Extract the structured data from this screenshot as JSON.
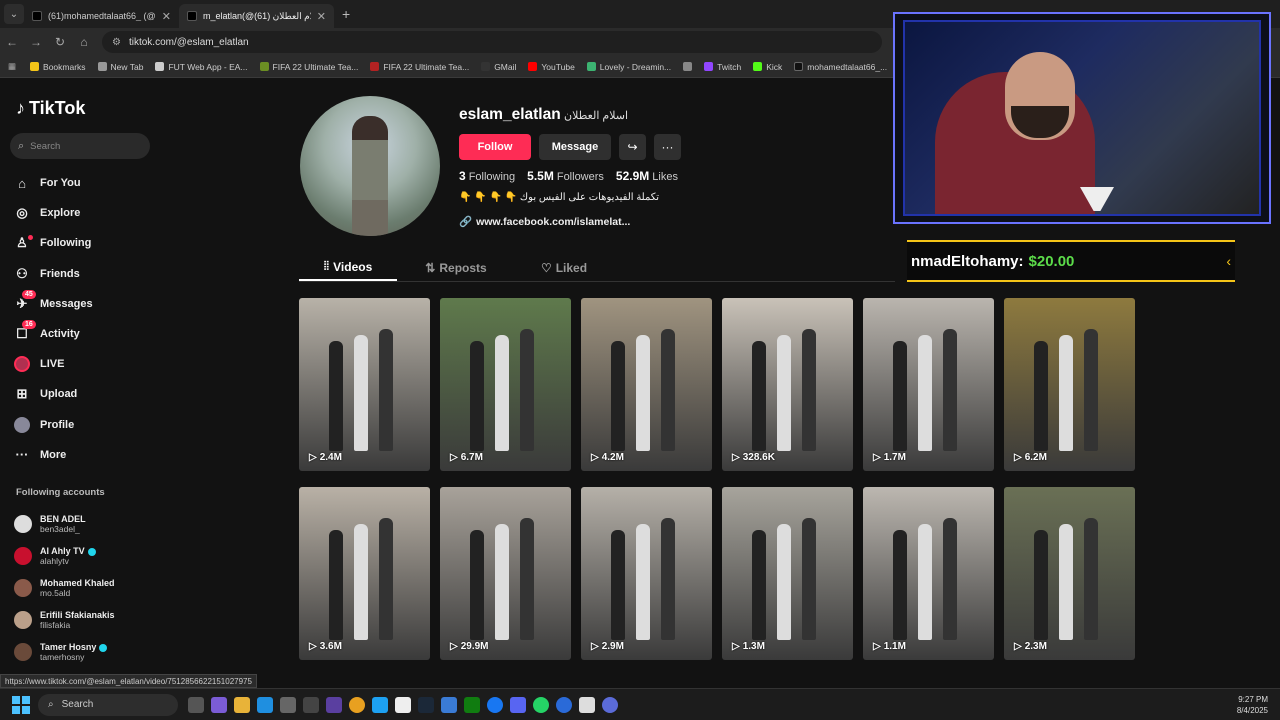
{
  "browser": {
    "tabs": [
      {
        "title": "(61)mohamedtalaat66_ (@moh",
        "active": false
      },
      {
        "title": "m_elatlan(@اسلام العطلان (61)",
        "active": true
      }
    ],
    "url": "tiktok.com/@eslam_elatlan",
    "bookmarks": [
      {
        "label": "Bookmarks",
        "color": "#f5c518"
      },
      {
        "label": "New Tab",
        "color": "#999999"
      },
      {
        "label": "FUT Web App - EA...",
        "color": "#cccccc"
      },
      {
        "label": "FIFA 22 Ultimate Tea...",
        "color": "#6b8e23"
      },
      {
        "label": "FIFA 22 Ultimate Tea...",
        "color": "#b22222"
      },
      {
        "label": "GMail",
        "color": "#333333"
      },
      {
        "label": "YouTube",
        "color": "#ff0000"
      },
      {
        "label": "Lovely - Dreamin...",
        "color": "#3cb371"
      },
      {
        "label": "",
        "color": "#888888"
      },
      {
        "label": "Twitch",
        "color": "#9146ff"
      },
      {
        "label": "Kick",
        "color": "#53fc18"
      },
      {
        "label": "mohamedtalaat66_...",
        "color": "#111111"
      }
    ],
    "status_url": "https://www.tiktok.com/@eslam_elatlan/video/7512856622151027975"
  },
  "sidebar": {
    "logo": "TikTok",
    "search_placeholder": "Search",
    "nav": [
      {
        "label": "For You",
        "icon": "home-icon"
      },
      {
        "label": "Explore",
        "icon": "compass-icon"
      },
      {
        "label": "Following",
        "icon": "following-icon"
      },
      {
        "label": "Friends",
        "icon": "friends-icon"
      },
      {
        "label": "Messages",
        "icon": "messages-icon",
        "badge": "45"
      },
      {
        "label": "Activity",
        "icon": "activity-icon",
        "badge": "16"
      },
      {
        "label": "LIVE",
        "icon": "live-icon"
      },
      {
        "label": "Upload",
        "icon": "upload-icon"
      },
      {
        "label": "Profile",
        "icon": "profile-icon"
      },
      {
        "label": "More",
        "icon": "more-icon"
      }
    ],
    "following_title": "Following accounts",
    "following": [
      {
        "name": "BEN ADEL",
        "handle": "ben3adel_",
        "verified": false,
        "color": "#dddddd"
      },
      {
        "name": "Al Ahly TV",
        "handle": "alahlytv",
        "verified": true,
        "color": "#c8102e"
      },
      {
        "name": "Mohamed Khaled",
        "handle": "mo.5ald",
        "verified": false,
        "color": "#8a5a4a"
      },
      {
        "name": "Erifili Sfakianakis",
        "handle": "filisfakia",
        "verified": false,
        "color": "#bba08a"
      },
      {
        "name": "Tamer Hosny",
        "handle": "tamerhosny",
        "verified": true,
        "color": "#6a4a3a"
      }
    ]
  },
  "profile": {
    "username": "eslam_elatlan",
    "display_name": "اسلام العطلان",
    "follow_label": "Follow",
    "message_label": "Message",
    "stats": [
      {
        "value": "3",
        "label": "Following"
      },
      {
        "value": "5.5M",
        "label": "Followers"
      },
      {
        "value": "52.9M",
        "label": "Likes"
      }
    ],
    "bio": "تكملة الفيديوهات على الفيس بوك 👇 👇 👇 👇",
    "link": "www.facebook.com/islamelat..."
  },
  "content_tabs": [
    {
      "label": "Videos",
      "active": true
    },
    {
      "label": "Reposts",
      "active": false
    },
    {
      "label": "Liked",
      "active": false
    }
  ],
  "videos": [
    {
      "views": "2.4M",
      "bg": "#b8b2a8"
    },
    {
      "views": "6.7M",
      "bg": "#5f7a4c"
    },
    {
      "views": "4.2M",
      "bg": "#a09480"
    },
    {
      "views": "328.6K",
      "bg": "#c9c2b8"
    },
    {
      "views": "1.7M",
      "bg": "#bab5ae"
    },
    {
      "views": "6.2M",
      "bg": "#8e7a3e"
    },
    {
      "views": "3.6M",
      "bg": "#b9b1a6"
    },
    {
      "views": "29.9M",
      "bg": "#a8a29a"
    },
    {
      "views": "2.9M",
      "bg": "#b5b0a8"
    },
    {
      "views": "1.3M",
      "bg": "#a7a49c"
    },
    {
      "views": "1.1M",
      "bg": "#bcb7b0"
    },
    {
      "views": "2.3M",
      "bg": "#6a7055"
    }
  ],
  "stream": {
    "donation_name": "nmadEltohamy:",
    "donation_amount": "$20.00"
  },
  "taskbar": {
    "search_placeholder": "Search",
    "time": "9:27 PM",
    "date": "8/4/2025"
  }
}
